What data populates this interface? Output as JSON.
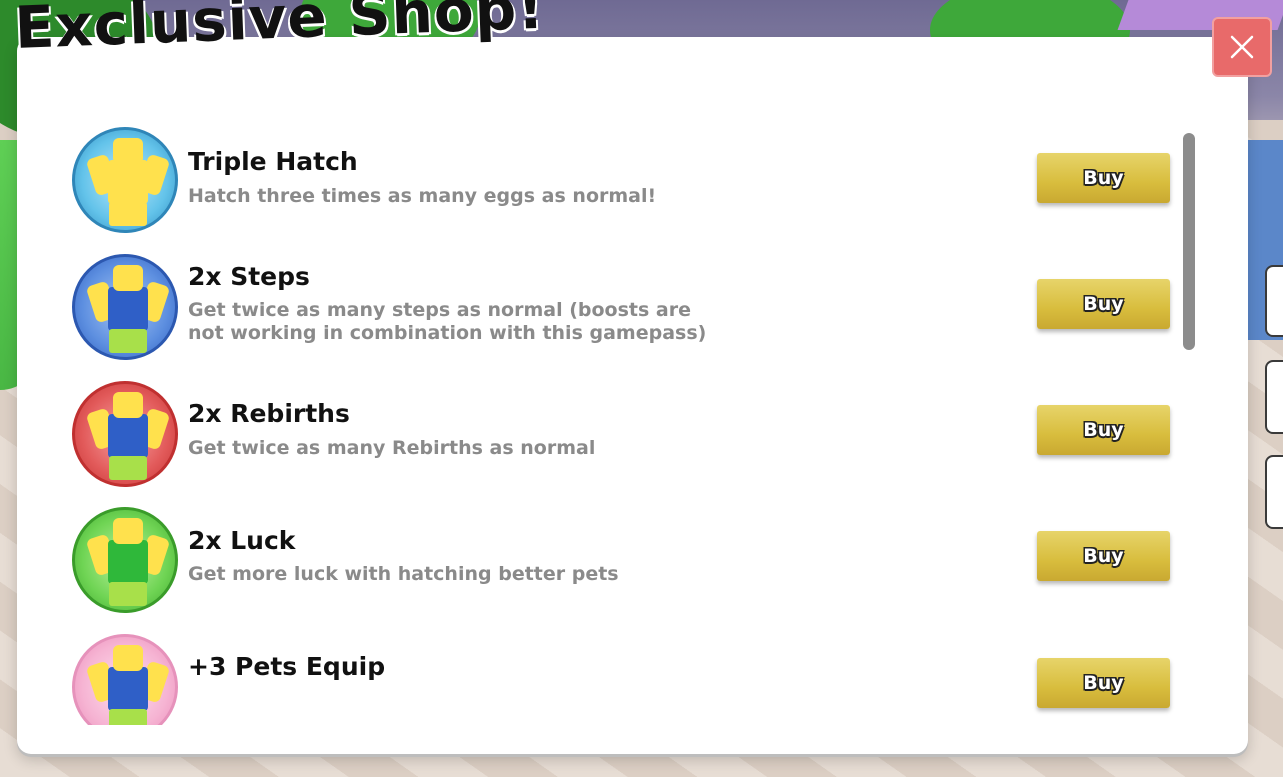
{
  "shop": {
    "title": "Exclusive Shop!",
    "close_icon": "close-icon",
    "buy_label": "Buy",
    "colors": {
      "close_button": "#e86a6a",
      "buy_button": "#d8bd3d",
      "item_name": "#111111",
      "item_desc": "#8a8a8a"
    },
    "items": [
      {
        "name": "Triple Hatch",
        "description": "Hatch three times as many eggs as normal!",
        "icon": "triple-hatch-badge-icon",
        "badge_color": "#3fa9d9"
      },
      {
        "name": "2x Steps",
        "description": "Get twice as many steps as normal (boosts are not working in combination with this gamepass)",
        "icon": "2x-steps-badge-icon",
        "badge_color": "#3a6fd0"
      },
      {
        "name": "2x Rebirths",
        "description": "Get twice as many Rebirths as normal",
        "icon": "2x-rebirths-badge-icon",
        "badge_color": "#e24a4a"
      },
      {
        "name": "2x Luck",
        "description": "Get more luck with hatching better pets",
        "icon": "2x-luck-badge-icon",
        "badge_color": "#4cc23a"
      },
      {
        "name": "+3 Pets Equip",
        "description": "",
        "icon": "3-pets-equip-badge-icon",
        "badge_color": "#f2a8cc"
      }
    ]
  }
}
